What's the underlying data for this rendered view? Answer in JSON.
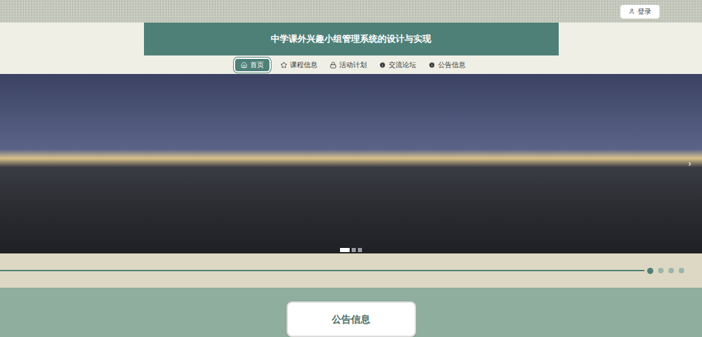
{
  "header": {
    "login": "登录",
    "title": "中学课外兴趣小组管理系统的设计与实现"
  },
  "nav": [
    {
      "label": "首页",
      "selected": true,
      "kind": "home"
    },
    {
      "label": "课程信息",
      "selected": false,
      "kind": "star"
    },
    {
      "label": "活动计划",
      "selected": false,
      "kind": "lock"
    },
    {
      "label": "交流论坛",
      "selected": false,
      "kind": "info"
    },
    {
      "label": "公告信息",
      "selected": false,
      "kind": "info"
    }
  ],
  "carousel": {
    "next": "›",
    "dots": [
      {
        "selected": true
      },
      {
        "selected": false
      },
      {
        "selected": false
      }
    ]
  },
  "progress_dots": [
    {
      "selected": true
    },
    {
      "selected": false
    },
    {
      "selected": false
    },
    {
      "selected": false
    }
  ],
  "section": {
    "title": "公告信息"
  }
}
